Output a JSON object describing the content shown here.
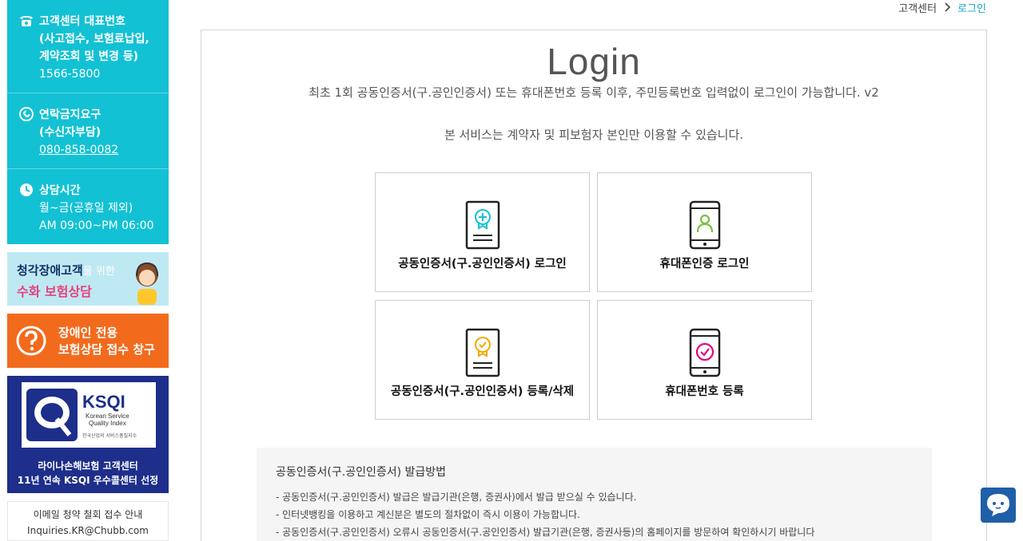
{
  "sidebar": {
    "contacts": [
      {
        "icon": "phone-icon",
        "title": "고객센터 대표번호\n(사고접수, 보험료납입,\n계약조회 및 변경 등)",
        "value": "1566-5800"
      },
      {
        "icon": "no-call-icon",
        "title": "연락금지요구\n(수신자부담)",
        "value": "080-858-0082"
      },
      {
        "icon": "clock-icon",
        "title": "상담시간",
        "value": "월~금(공휴일 제외)\nAM 09:00~PM 06:00"
      }
    ],
    "sign_banner": {
      "line1": "청각장애고객",
      "line1_small": "을 위한",
      "line2": "수화 보험상담"
    },
    "disabled_banner": {
      "text": "장애인 전용\n보험상담 접수 창구"
    },
    "ksqi": {
      "name": "KSQI",
      "sub": "Korean Service\nQuality Index",
      "kor": "한국산업의 서비스품질지수",
      "caption": "라이나손해보험 고객센터\n11년 연속 KSQI 우수콜센터 선정"
    },
    "email": {
      "line1": "이메일 청약 철회 접수 안내",
      "line2": "Inquiries.KR@Chubb.com"
    }
  },
  "breadcrumb": {
    "home": "고객센터",
    "current": "로그인"
  },
  "main": {
    "title": "Login",
    "description": "최초 1회 공동인증서(구.공인인증서) 또는 휴대폰번호 등록 이후, 주민등록번호 입력없이 로그인이 가능합니다. v2",
    "notice": "본 서비스는 계약자 및 피보험자 본인만 이용할 수 있습니다.",
    "tiles": [
      {
        "label": "공동인증서(구.공인인증서) 로그인",
        "icon": "certificate-login-icon"
      },
      {
        "label": "휴대폰인증 로그인",
        "icon": "phone-person-icon"
      },
      {
        "label": "공동인증서(구.공인인증서) 등록/삭제",
        "icon": "certificate-register-icon"
      },
      {
        "label": "휴대폰번호 등록",
        "icon": "phone-check-icon"
      }
    ],
    "guide": {
      "title": "공동인증서(구.공인인증서) 발급방법",
      "lines": [
        "- 공동인증서(구.공인인증서) 발급은 발급기관(은행, 증권사)에서 발급 받으실 수 있습니다.",
        "- 인터넷뱅킹을 이용하고 계신분은 별도의 절차없이 즉시 이용이 가능합니다.",
        "- 공동인증서(구.공인인증서) 오류시 공동인증서(구.공인인증서) 발급기관(은행, 증권사등)의 홈페이지를 방문하여 확인하시기 바랍니다"
      ]
    }
  },
  "colors": {
    "accent": "#13c1d4",
    "orange": "#f26b1d",
    "navy": "#1d2e8b",
    "chatbot": "#1f5fa8"
  }
}
